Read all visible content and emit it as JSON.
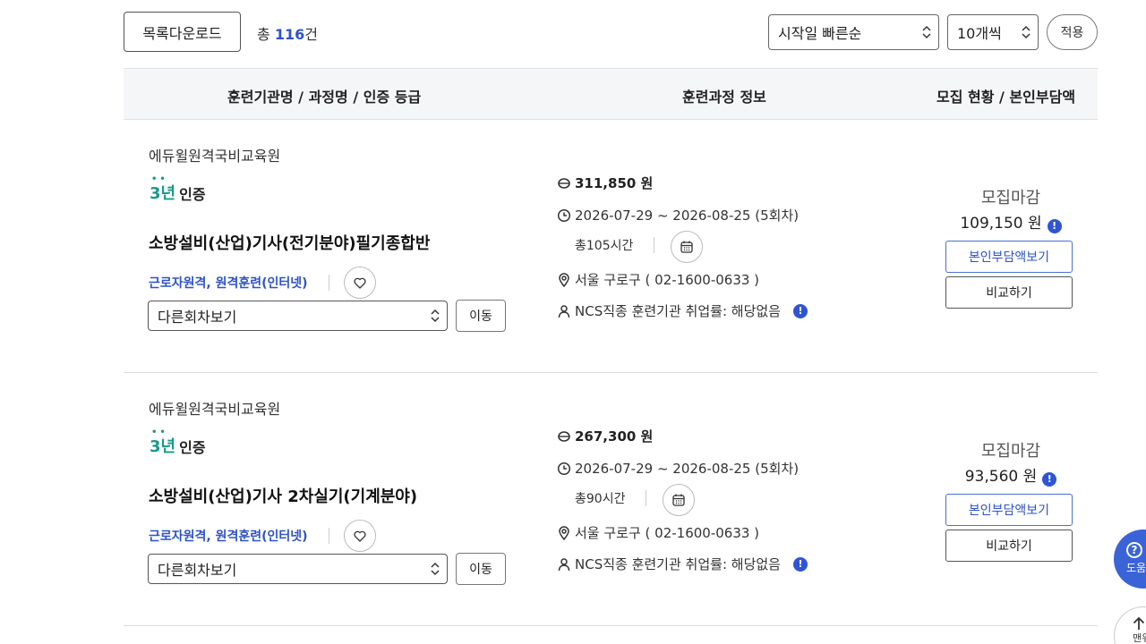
{
  "toolbar": {
    "download_label": "목록다운로드",
    "total_prefix": "총",
    "total_count": "116",
    "total_suffix": "건",
    "sort_selected": "시작일 빠른순",
    "per_page_selected": "10개씩",
    "apply_label": "적용"
  },
  "table_header": {
    "col1": "훈련기관명 / 과정명 / 인증 등급",
    "col2": "훈련과정 정보",
    "col3": "모집 현황 / 본인부담액"
  },
  "courses": [
    {
      "institution": "에듀윌원격국비교육원",
      "cert_badge": "3년",
      "cert_label": "인증",
      "title": "소방설비(산업)기사(전기분야)필기종합반",
      "types": "근로자원격, 원격훈련(인터넷)",
      "round_select": "다른회차보기",
      "move_label": "이동",
      "price": "311,850 원",
      "period": "2026-07-29 ~ 2026-08-25 (5회차)",
      "hours": "총105시간",
      "location": "서울 구로구 ( 02-1600-0633 )",
      "employment": "NCS직종 훈련기관 취업률: 해당없음",
      "status": "모집마감",
      "self_fee": "109,150 원",
      "self_fee_button": "본인부담액보기",
      "compare_button": "비교하기"
    },
    {
      "institution": "에듀윌원격국비교육원",
      "cert_badge": "3년",
      "cert_label": "인증",
      "title": "소방설비(산업)기사 2차실기(기계분야)",
      "types": "근로자원격, 원격훈련(인터넷)",
      "round_select": "다른회차보기",
      "move_label": "이동",
      "price": "267,300 원",
      "period": "2026-07-29 ~ 2026-08-25 (5회차)",
      "hours": "총90시간",
      "location": "서울 구로구 ( 02-1600-0633 )",
      "employment": "NCS직종 훈련기관 취업률: 해당없음",
      "status": "모집마감",
      "self_fee": "93,560 원",
      "self_fee_button": "본인부담액보기",
      "compare_button": "비교하기"
    }
  ],
  "floating": {
    "help_label": "도움",
    "top_label": "맨위"
  },
  "colors": {
    "accent": "#2e53c9",
    "cert": "#1a9a8a",
    "fab": "#3a63d8"
  }
}
